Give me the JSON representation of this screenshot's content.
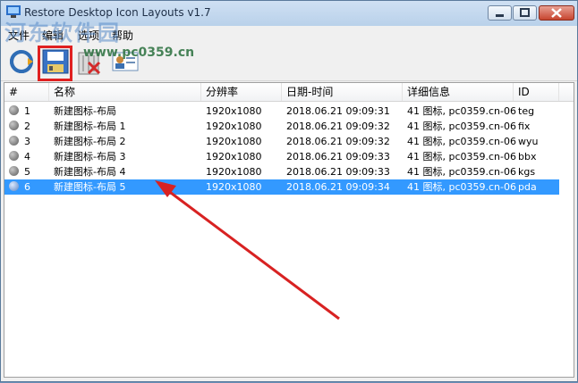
{
  "window": {
    "title": "Restore Desktop Icon Layouts v1.7"
  },
  "watermark": {
    "text": "河东软件园",
    "url": "www.pc0359.cn"
  },
  "menu": {
    "items": [
      "文件",
      "编辑",
      "选项",
      "帮助"
    ]
  },
  "toolbar": {
    "buttons": [
      "refresh-icon",
      "save-layout-icon",
      "delete-layout-icon",
      "info-icon"
    ]
  },
  "table": {
    "columns": [
      "#",
      "名称",
      "分辨率",
      "日期-时间",
      "详细信息",
      "ID"
    ],
    "rows": [
      {
        "num": "1",
        "name": "新建图标-布局",
        "res": "1920x1080",
        "dt": "2018.06.21 09:09:31",
        "detail": "41 图标, pc0359.cn-06",
        "id": "teg"
      },
      {
        "num": "2",
        "name": "新建图标-布局 1",
        "res": "1920x1080",
        "dt": "2018.06.21 09:09:32",
        "detail": "41 图标, pc0359.cn-06",
        "id": "fix"
      },
      {
        "num": "3",
        "name": "新建图标-布局 2",
        "res": "1920x1080",
        "dt": "2018.06.21 09:09:32",
        "detail": "41 图标, pc0359.cn-06",
        "id": "wyu"
      },
      {
        "num": "4",
        "name": "新建图标-布局 3",
        "res": "1920x1080",
        "dt": "2018.06.21 09:09:33",
        "detail": "41 图标, pc0359.cn-06",
        "id": "bbx"
      },
      {
        "num": "5",
        "name": "新建图标-布局 4",
        "res": "1920x1080",
        "dt": "2018.06.21 09:09:33",
        "detail": "41 图标, pc0359.cn-06",
        "id": "kgs"
      },
      {
        "num": "6",
        "name": "新建图标-布局 5",
        "res": "1920x1080",
        "dt": "2018.06.21 09:09:34",
        "detail": "41 图标, pc0359.cn-06",
        "id": "pda"
      }
    ],
    "selected_index": 5
  },
  "colors": {
    "selection": "#3399ff",
    "annotation": "#e02020"
  }
}
